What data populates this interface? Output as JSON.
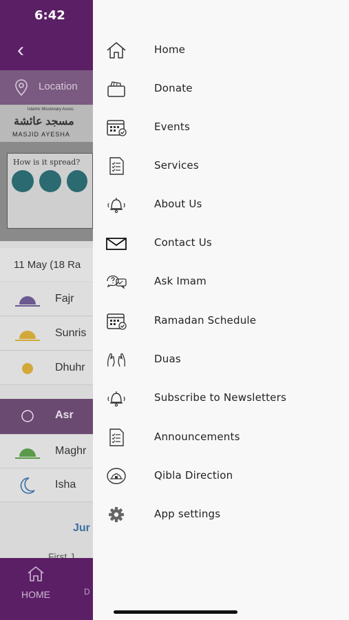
{
  "status": {
    "time": "6:42"
  },
  "app": {
    "location_label": "Location",
    "banner": {
      "org_line": "Islamic Missionary Assoc.",
      "arabic_name": "مسجد عائشة",
      "name": "MASJID AYESHA",
      "poster_title": "How is it spread?"
    },
    "date": "11 May (18 Ra",
    "prayers": [
      {
        "name": "Fajr",
        "icon": "sunrise-icon"
      },
      {
        "name": "Sunris",
        "icon": "sunrise-icon"
      },
      {
        "name": "Dhuhr",
        "icon": "sun-icon"
      },
      {
        "name": "Asr",
        "icon": "sun-outline-icon",
        "active": true
      },
      {
        "name": "Maghr",
        "icon": "sunset-icon"
      },
      {
        "name": "Isha",
        "icon": "moon-icon"
      }
    ],
    "jumuah_label": "Jur",
    "first_label": "First J",
    "tabs": [
      {
        "label": "HOME",
        "icon": "home-icon"
      },
      {
        "label": "D"
      }
    ]
  },
  "drawer": {
    "items": [
      {
        "label": "Home",
        "icon": "home-icon"
      },
      {
        "label": "Donate",
        "icon": "wallet-icon"
      },
      {
        "label": "Events",
        "icon": "calendar-icon"
      },
      {
        "label": "Services",
        "icon": "checklist-icon"
      },
      {
        "label": "About Us",
        "icon": "bell-icon"
      },
      {
        "label": "Contact Us",
        "icon": "envelope-icon"
      },
      {
        "label": "Ask Imam",
        "icon": "chat-question-icon"
      },
      {
        "label": "Ramadan Schedule",
        "icon": "calendar-icon"
      },
      {
        "label": "Duas",
        "icon": "praying-hands-icon"
      },
      {
        "label": "Subscribe to Newsletters",
        "icon": "bell-icon"
      },
      {
        "label": "Announcements",
        "icon": "checklist-icon"
      },
      {
        "label": "Qibla Direction",
        "icon": "qibla-icon"
      },
      {
        "label": "App settings",
        "icon": "gear-icon"
      }
    ]
  },
  "colors": {
    "purple_dark": "#5b1f66",
    "purple_active": "#6a4a70",
    "drawer_bg": "#f8f8f8"
  }
}
